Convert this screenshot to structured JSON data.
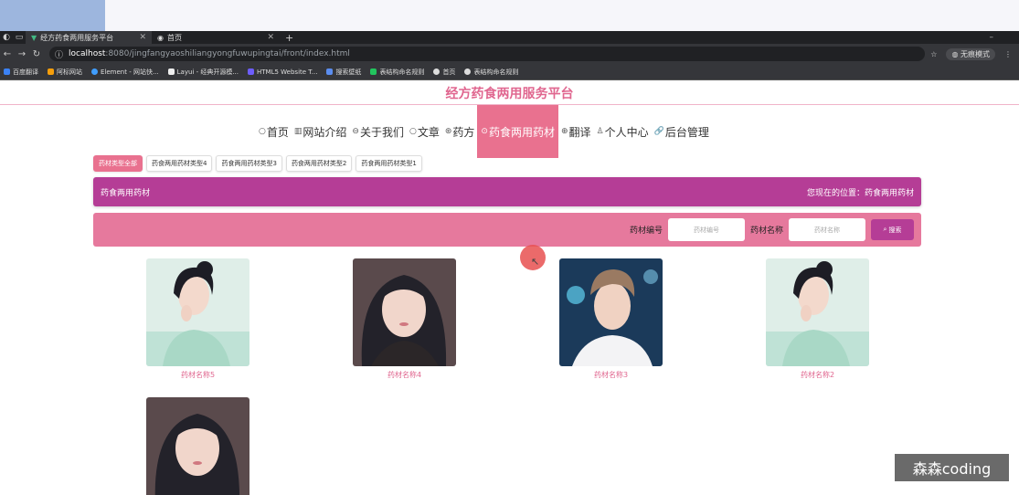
{
  "browser": {
    "tabs": [
      {
        "title": "经方药食两用服务平台",
        "active": true
      },
      {
        "title": "首页",
        "active": false
      }
    ],
    "url_host": "localhost",
    "url_path": ":8080/jingfangyaoshiliangyongfuwupingtai/front/index.html",
    "incognito_label": "无痕模式",
    "bookmarks": [
      "百度翻译",
      "阿标网站",
      "Element - 网站快...",
      "Layui - 经典开源模...",
      "HTML5 Website T...",
      "搜索壁纸",
      "表结构命名规则",
      "首页",
      "表结构命名规则"
    ]
  },
  "site": {
    "title": "经方药食两用服务平台"
  },
  "nav": {
    "items": [
      {
        "label": "首页",
        "icon": "○"
      },
      {
        "label": "网站介绍",
        "icon": "▥"
      },
      {
        "label": "关于我们",
        "icon": "⊖"
      },
      {
        "label": "文章",
        "icon": "○"
      },
      {
        "label": "药方",
        "icon": "⊛"
      },
      {
        "label": "药食两用药材",
        "icon": "⊙"
      },
      {
        "label": "翻译",
        "icon": "⊕"
      },
      {
        "label": "个人中心",
        "icon": "♙"
      },
      {
        "label": "后台管理",
        "icon": "🔗"
      }
    ],
    "active_index": 5
  },
  "types": {
    "items": [
      "药材类型全部",
      "药食两用药材类型4",
      "药食两用药材类型3",
      "药食两用药材类型2",
      "药食两用药材类型1"
    ],
    "active_index": 0
  },
  "section": {
    "title": "药食两用药材",
    "breadcrumb": "您现在的位置：药食两用药材"
  },
  "search": {
    "code_label": "药材编号",
    "code_placeholder": "药材编号",
    "name_label": "药材名称",
    "name_placeholder": "药材名称",
    "button_label": "搜索"
  },
  "items": [
    {
      "name": "药材名称5"
    },
    {
      "name": "药材名称4"
    },
    {
      "name": "药材名称3"
    },
    {
      "name": "药材名称2"
    },
    {
      "name": ""
    }
  ],
  "watermark": "森森coding",
  "colors": {
    "accent_pink": "#e9718f",
    "accent_purple": "#b53d96",
    "title_pink": "#e0668f"
  }
}
